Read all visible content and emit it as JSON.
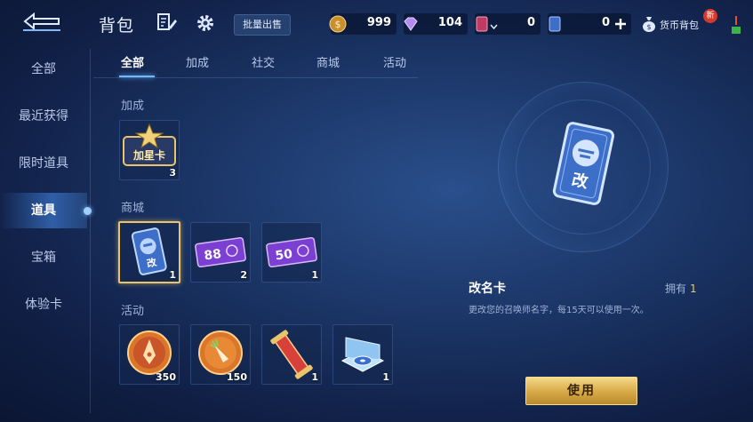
{
  "header": {
    "title": "背包",
    "bulk_sell_label": "批量出售",
    "currency_bag_label": "货币背包",
    "new_badge": "新"
  },
  "resources": [
    {
      "icon": "gold-coin-icon",
      "value": "999"
    },
    {
      "icon": "diamond-icon",
      "value": "104"
    },
    {
      "icon": "red-card-icon",
      "value": "0"
    },
    {
      "icon": "blue-card-icon",
      "value": "0"
    }
  ],
  "sidebar": {
    "items": [
      {
        "label": "全部"
      },
      {
        "label": "最近获得"
      },
      {
        "label": "限时道具"
      },
      {
        "label": "道具"
      },
      {
        "label": "宝箱"
      },
      {
        "label": "体验卡"
      }
    ],
    "active_index": 3
  },
  "tabs": [
    {
      "label": "全部"
    },
    {
      "label": "加成"
    },
    {
      "label": "社交"
    },
    {
      "label": "商城"
    },
    {
      "label": "活动"
    }
  ],
  "sections": [
    {
      "label": "加成",
      "items": [
        {
          "icon": "star-card-icon",
          "art_text": "加星卡",
          "count": "3"
        }
      ]
    },
    {
      "label": "商城",
      "items": [
        {
          "icon": "rename-card-icon",
          "art_text": "改",
          "count": "1"
        },
        {
          "icon": "coupon-88-icon",
          "art_text": "88",
          "count": "2"
        },
        {
          "icon": "coupon-50-icon",
          "art_text": "50",
          "count": "1"
        }
      ]
    },
    {
      "label": "活动",
      "items": [
        {
          "icon": "pen-medal-icon",
          "count": "350"
        },
        {
          "icon": "carrot-medal-icon",
          "count": "150"
        },
        {
          "icon": "scroll-icon",
          "count": "1"
        },
        {
          "icon": "disc-box-icon",
          "count": "1"
        }
      ]
    }
  ],
  "detail": {
    "name": "改名卡",
    "owned_label": "拥有",
    "owned_count": "1",
    "description": "更改您的召唤师名字，每15天可以使用一次。",
    "card_text": "改",
    "use_label": "使用"
  },
  "colors": {
    "accent_gold": "#e9c46a",
    "active_blue": "#6fb8ff"
  }
}
